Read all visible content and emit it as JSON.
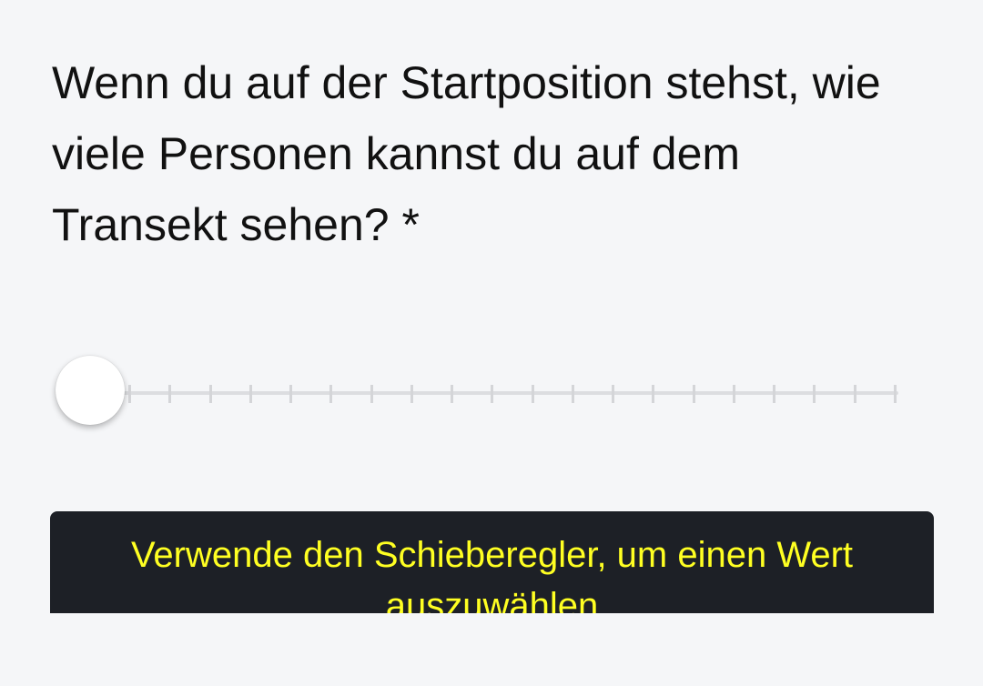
{
  "question": {
    "text": "Wenn du auf der Startposition stehst, wie viele Personen kannst du auf dem Transekt sehen? *"
  },
  "slider": {
    "value": 0,
    "tick_count": 20
  },
  "hint": {
    "text": "Verwende den Schieberegler, um einen Wert auszuwählen"
  },
  "colors": {
    "background": "#f5f6f8",
    "hint_background": "#1d2026",
    "hint_text": "#ffff22"
  }
}
